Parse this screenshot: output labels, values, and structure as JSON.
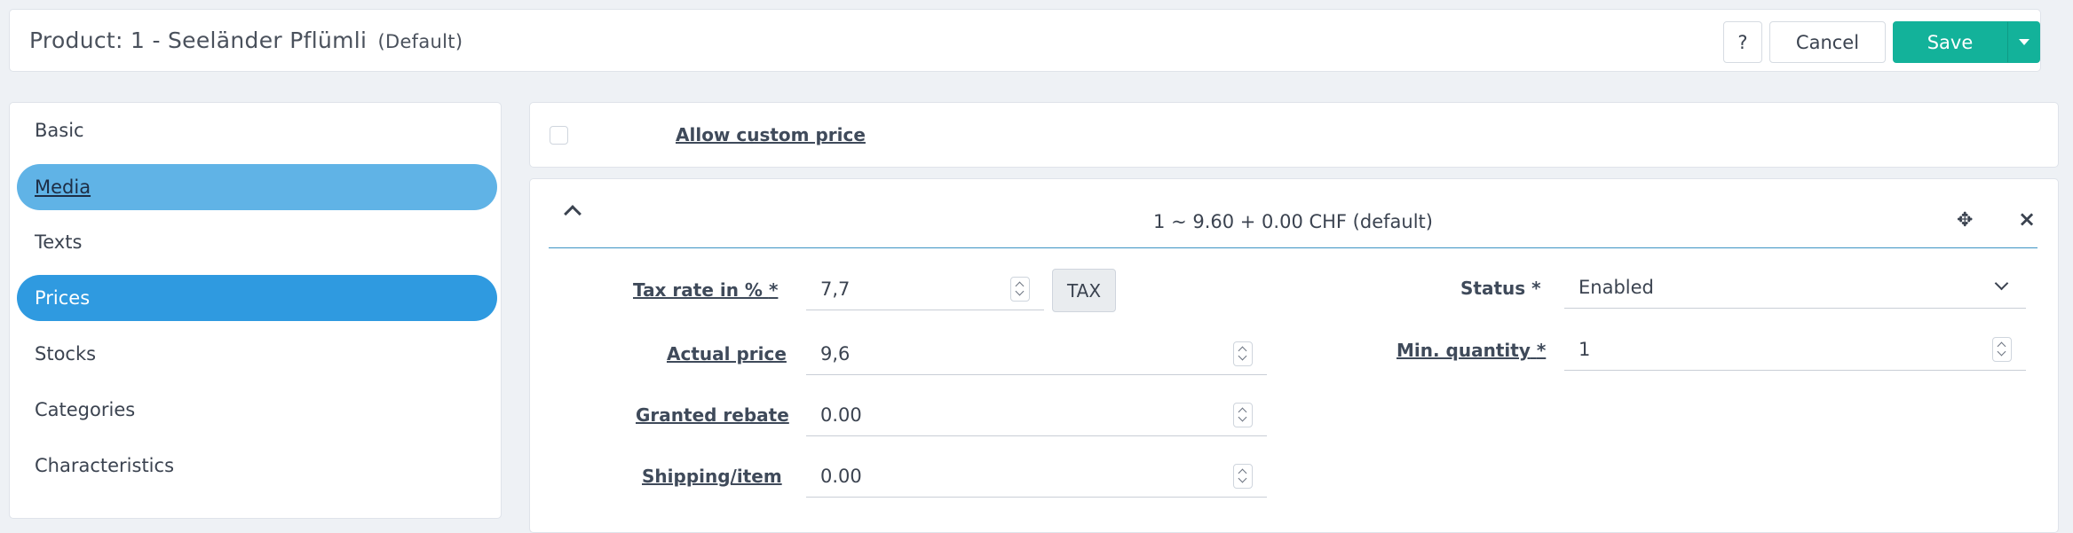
{
  "header": {
    "title": "Product: 1 - Seeländer Pflümli",
    "variant": "(Default)",
    "help_label": "?",
    "cancel_label": "Cancel",
    "save_label": "Save"
  },
  "sidebar": {
    "items": [
      {
        "label": "Basic"
      },
      {
        "label": "Media"
      },
      {
        "label": "Texts"
      },
      {
        "label": "Prices"
      },
      {
        "label": "Stocks"
      },
      {
        "label": "Categories"
      },
      {
        "label": "Characteristics"
      }
    ]
  },
  "custom_price": {
    "label": "Allow custom price",
    "checked": false
  },
  "price": {
    "title": "1 ~ 9.60 + 0.00 CHF (default)",
    "tax_rate_label": "Tax rate in %",
    "tax_rate_value": "7,7",
    "tax_button": "TAX",
    "actual_price_label": "Actual price",
    "actual_price_value": "9,6",
    "granted_rebate_label": "Granted rebate",
    "granted_rebate_value": "0.00",
    "shipping_label": "Shipping/item",
    "shipping_value": "0.00",
    "status_label": "Status *",
    "status_value": "Enabled",
    "min_quantity_label": "Min. quantity",
    "min_quantity_value": "1",
    "required_mark": "*"
  },
  "colors": {
    "save": "#13b29a",
    "nav_active": "#2f9ae0",
    "nav_hover": "#60b3e6"
  }
}
